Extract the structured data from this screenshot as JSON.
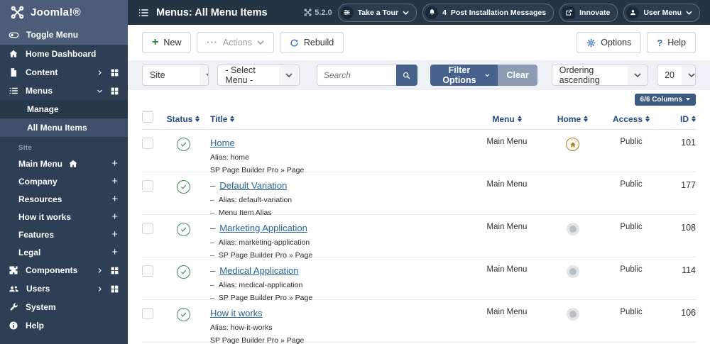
{
  "topbar": {
    "brand": "Joomla!®",
    "title": "Menus: All Menu Items",
    "version": "5.2.0",
    "tour": "Take a Tour",
    "messages_count": "4",
    "messages": "Post Installation Messages",
    "innovate": "Innovate",
    "user_menu": "User Menu"
  },
  "sidebar": {
    "toggle": "Toggle Menu",
    "home_dashboard": "Home Dashboard",
    "content": "Content",
    "menus": "Menus",
    "manage": "Manage",
    "all_menu_items": "All Menu Items",
    "site_heading": "Site",
    "site_items": [
      {
        "label": "Main Menu",
        "plus": "+"
      },
      {
        "label": "Company",
        "plus": "+"
      },
      {
        "label": "Resources",
        "plus": "+"
      },
      {
        "label": "How it works",
        "plus": "+"
      },
      {
        "label": "Features",
        "plus": "+"
      },
      {
        "label": "Legal",
        "plus": "+"
      }
    ],
    "components": "Components",
    "users": "Users",
    "system": "System",
    "help": "Help"
  },
  "toolbar": {
    "new": "New",
    "actions": "Actions",
    "rebuild": "Rebuild",
    "options": "Options",
    "help": "Help"
  },
  "filters": {
    "site": "Site",
    "menu": "- Select Menu -",
    "search_placeholder": "Search",
    "filter_options": "Filter Options",
    "clear": "Clear",
    "ordering": "Ordering ascending",
    "limit": "20",
    "columns": "6/6 Columns"
  },
  "table": {
    "headers": {
      "status": "Status",
      "title": "Title",
      "menu": "Menu",
      "home": "Home",
      "access": "Access",
      "id": "ID"
    },
    "rows": [
      {
        "prefix": "",
        "title": "Home",
        "alias": "Alias: home",
        "note": "SP Page Builder Pro » Page",
        "menu": "Main Menu",
        "home_default": true,
        "home_unset": false,
        "access": "Public",
        "id": "101"
      },
      {
        "prefix": "–",
        "title": "Default Variation",
        "alias": "Alias: default-variation",
        "note": "Menu Item Alias",
        "menu": "Main Menu",
        "home_default": false,
        "home_unset": false,
        "access": "Public",
        "id": "177"
      },
      {
        "prefix": "–",
        "title": "Marketing Application",
        "alias": "Alias: marketing-application",
        "note": "SP Page Builder Pro » Page",
        "menu": "Main Menu",
        "home_default": false,
        "home_unset": true,
        "access": "Public",
        "id": "108"
      },
      {
        "prefix": "–",
        "title": "Medical Application",
        "alias": "Alias: medical-application",
        "note": "SP Page Builder Pro » Page",
        "menu": "Main Menu",
        "home_default": false,
        "home_unset": true,
        "access": "Public",
        "id": "114"
      },
      {
        "prefix": "",
        "title": "How it works",
        "alias": "Alias: how-it-works",
        "note": "SP Page Builder Pro » Page",
        "menu": "Main Menu",
        "home_default": false,
        "home_unset": true,
        "access": "Public",
        "id": "106"
      }
    ]
  },
  "colors": {
    "topbar": "#253442",
    "brand_bg": "#4d5d79",
    "sidebar": "#2e3e54",
    "primary_button": "#45618c",
    "clear_button": "#8d9cb3",
    "link": "#2a6496",
    "status_published": "#3f8a4e",
    "home_default_gold": "#a8862f",
    "header_text": "#264a86"
  }
}
